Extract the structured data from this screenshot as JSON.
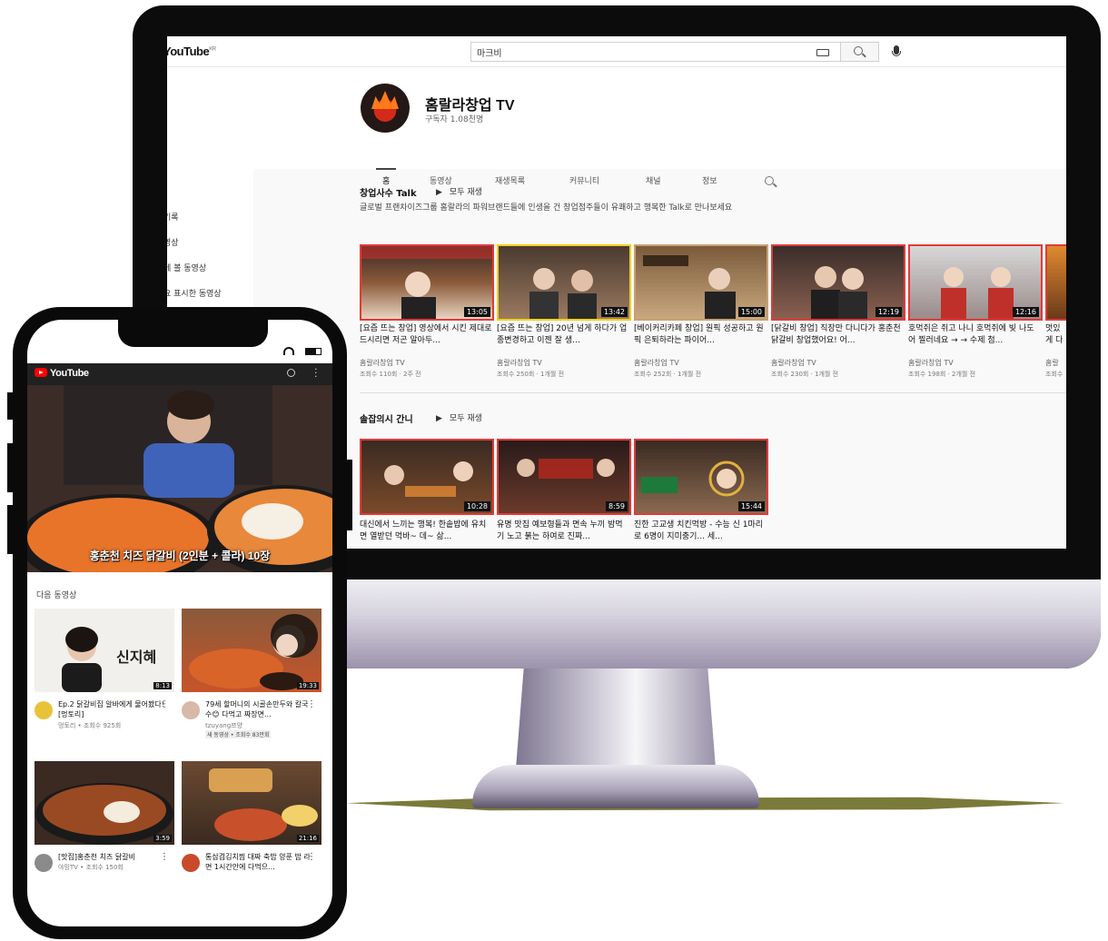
{
  "desktop": {
    "logo": "YouTube",
    "logo_region": "KR",
    "search": {
      "value": "마크비"
    },
    "sidebar": [
      {
        "label": "!"
      },
      {
        "label": "기록"
      },
      {
        "label": "영상"
      },
      {
        "label": "에 볼 동영상"
      },
      {
        "label": "요 표시한 동영상"
      }
    ],
    "channel": {
      "name": "홈랄라창업 TV",
      "subscribers": "구독자 1.08천명"
    },
    "tabs": [
      {
        "label": "홈"
      },
      {
        "label": "동영상"
      },
      {
        "label": "재생목록"
      },
      {
        "label": "커뮤니티"
      },
      {
        "label": "채널"
      },
      {
        "label": "정보"
      }
    ],
    "section1": {
      "title": "창업사수 Talk",
      "play_all": "모두 재생",
      "description": "글로벌 프랜차이즈그룹 홈랄라의 파워브랜드들에 인생을 건 창업점주들이 유쾌하고 행복한 Talk로 만나보세요",
      "videos": [
        {
          "duration": "13:05",
          "title": "[요즘 뜨는 창업] 영상에서 시킨 제대로 드시리면 저곤 알아두...",
          "channel": "홈랄라창업 TV",
          "meta": "조회수 110회 · 2주 전"
        },
        {
          "duration": "13:42",
          "title": "[요즘 뜨는 창업] 20년 넘게 하다가 업종변경하고 이젠 잘 생...",
          "channel": "홈랄라창업 TV",
          "meta": "조회수 250회 · 1개월 전"
        },
        {
          "duration": "15:00",
          "title": "[베이커리카페 창업] 원픽 성공하고 원픽 은퇴하라는 파이어...",
          "channel": "홈랄라창업 TV",
          "meta": "조회수 252회 · 1개월 전"
        },
        {
          "duration": "12:19",
          "title": "[닭갈비 창업] 직장만 다니다가 홍춘천 닭갈비 창업했어요! 어...",
          "channel": "홈랄라창업 TV",
          "meta": "조회수 230회 · 1개월 전"
        },
        {
          "duration": "12:16",
          "title": "호먹쥐은 쥐고 나니 호먹쥐에 빚 나도어 찔러네요 → → 수제 첨...",
          "channel": "홈랄라창업 TV",
          "meta": "조회수 198회 · 2개월 전"
        },
        {
          "duration": "",
          "title": "멋있게 다 가...",
          "channel": "홈랄",
          "meta": "조회수"
        }
      ]
    },
    "section2": {
      "title": "솔잡의시 간니",
      "play_all": "모두 재생",
      "videos": [
        {
          "duration": "10:28",
          "title": "대신에서 느끼는 행복! 한솥밥에 유치면 열받던 먹바~ 데~ 삶..."
        },
        {
          "duration": "8:59",
          "title": "유명 맛집 예보형들과 면속 누끼 밤먹기 노고 붉는 하여로 진짜..."
        },
        {
          "duration": "15:44",
          "title": "진한 고교생 치킨먹방 - 수능 신 1마리로 6명이 지미충기... 세..."
        }
      ]
    }
  },
  "mobile": {
    "logo": "YouTube",
    "hero_caption": "홍춘천 치즈 닭갈비 (2인분 + 콜라) 10장",
    "next_label": "다음 동영상",
    "videos": [
      {
        "duration": "8:13",
        "overlay_text": "신지혜",
        "title": "Ep.2 닭갈비집 알바에게 물어봤다! [멍토리]",
        "meta": "멍토리 • 조회수 925회",
        "badge": ""
      },
      {
        "duration": "19:33",
        "overlay_text": "",
        "title": "79세 할머니의 시골손만두와 칼국수😊 다먹고 짜장면...",
        "meta": "tzuyang쯔양",
        "badge": "새 동영상 • 조회수 83만회"
      },
      {
        "duration": "3:59",
        "overlay_text": "",
        "title": "[맛집]홍춘천 치즈 닭갈비",
        "meta": "야밍TV • 조회수 150회",
        "badge": ""
      },
      {
        "duration": "21:16",
        "overlay_text": "",
        "title": "통삼겹김치찜 대짜 축밥 양푼 밥 라면 1시간안에 다먹으...",
        "meta": "",
        "badge": ""
      }
    ]
  }
}
